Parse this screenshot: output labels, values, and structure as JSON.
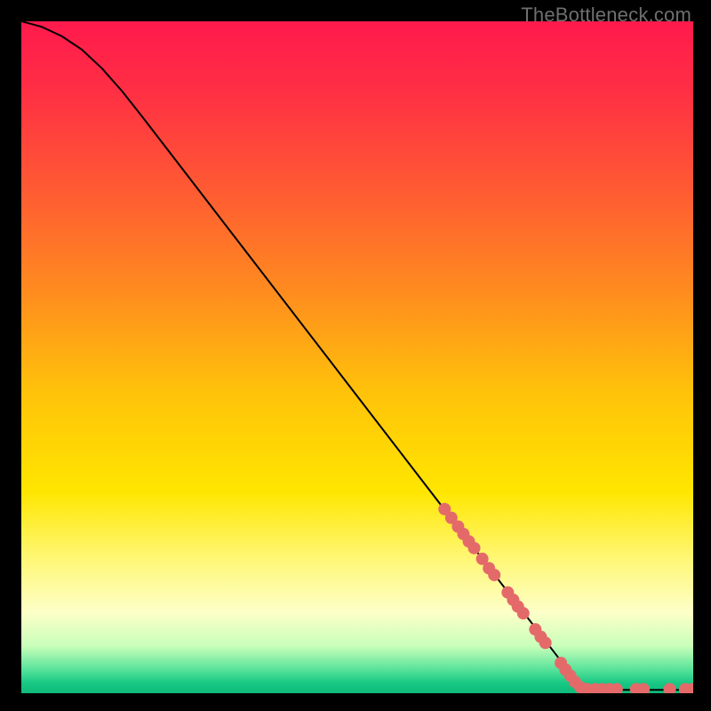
{
  "watermark": "TheBottleneck.com",
  "chart_data": {
    "type": "line",
    "title": "",
    "xlabel": "",
    "ylabel": "",
    "xlim": [
      0,
      100
    ],
    "ylim": [
      0,
      100
    ],
    "grid": false,
    "legend": false,
    "gradient_stops": [
      {
        "offset": 0.0,
        "color": "#ff1a4d"
      },
      {
        "offset": 0.1,
        "color": "#ff2e44"
      },
      {
        "offset": 0.25,
        "color": "#ff5a33"
      },
      {
        "offset": 0.4,
        "color": "#ff8b1f"
      },
      {
        "offset": 0.55,
        "color": "#ffc20a"
      },
      {
        "offset": 0.7,
        "color": "#ffe600"
      },
      {
        "offset": 0.8,
        "color": "#fff776"
      },
      {
        "offset": 0.88,
        "color": "#fdffc8"
      },
      {
        "offset": 0.93,
        "color": "#c8ffba"
      },
      {
        "offset": 0.965,
        "color": "#57e29a"
      },
      {
        "offset": 0.985,
        "color": "#17c884"
      },
      {
        "offset": 1.0,
        "color": "#0fba7a"
      }
    ],
    "series": [
      {
        "name": "curve",
        "render": "line",
        "color": "#000000",
        "points": [
          {
            "x": 0.0,
            "y": 100.0
          },
          {
            "x": 3.0,
            "y": 99.2
          },
          {
            "x": 6.0,
            "y": 97.8
          },
          {
            "x": 9.0,
            "y": 95.8
          },
          {
            "x": 12.0,
            "y": 93.0
          },
          {
            "x": 15.0,
            "y": 89.6
          },
          {
            "x": 18.0,
            "y": 85.8
          },
          {
            "x": 22.0,
            "y": 80.6
          },
          {
            "x": 28.0,
            "y": 72.8
          },
          {
            "x": 36.0,
            "y": 62.4
          },
          {
            "x": 46.0,
            "y": 49.4
          },
          {
            "x": 58.0,
            "y": 33.8
          },
          {
            "x": 66.0,
            "y": 23.4
          },
          {
            "x": 74.0,
            "y": 13.0
          },
          {
            "x": 80.0,
            "y": 5.2
          },
          {
            "x": 83.5,
            "y": 1.0
          },
          {
            "x": 85.0,
            "y": 0.5
          },
          {
            "x": 90.0,
            "y": 0.5
          },
          {
            "x": 95.0,
            "y": 0.5
          },
          {
            "x": 100.0,
            "y": 0.5
          }
        ]
      },
      {
        "name": "markers",
        "render": "scatter",
        "color": "#e46a6a",
        "radius": 7,
        "points": [
          {
            "x": 63.0,
            "y": 27.4
          },
          {
            "x": 64.0,
            "y": 26.1
          },
          {
            "x": 65.0,
            "y": 24.8
          },
          {
            "x": 65.8,
            "y": 23.7
          },
          {
            "x": 66.6,
            "y": 22.6
          },
          {
            "x": 67.4,
            "y": 21.6
          },
          {
            "x": 68.6,
            "y": 20.0
          },
          {
            "x": 69.6,
            "y": 18.6
          },
          {
            "x": 70.4,
            "y": 17.6
          },
          {
            "x": 72.4,
            "y": 15.0
          },
          {
            "x": 73.2,
            "y": 13.9
          },
          {
            "x": 73.9,
            "y": 12.9
          },
          {
            "x": 74.7,
            "y": 11.9
          },
          {
            "x": 76.5,
            "y": 9.5
          },
          {
            "x": 77.3,
            "y": 8.4
          },
          {
            "x": 78.0,
            "y": 7.5
          },
          {
            "x": 80.3,
            "y": 4.5
          },
          {
            "x": 81.0,
            "y": 3.5
          },
          {
            "x": 81.7,
            "y": 2.6
          },
          {
            "x": 82.4,
            "y": 1.7
          },
          {
            "x": 83.2,
            "y": 0.9
          },
          {
            "x": 84.2,
            "y": 0.6
          },
          {
            "x": 85.4,
            "y": 0.6
          },
          {
            "x": 86.4,
            "y": 0.6
          },
          {
            "x": 87.5,
            "y": 0.6
          },
          {
            "x": 88.6,
            "y": 0.6
          },
          {
            "x": 91.5,
            "y": 0.6
          },
          {
            "x": 92.6,
            "y": 0.6
          },
          {
            "x": 96.5,
            "y": 0.6
          },
          {
            "x": 98.8,
            "y": 0.6
          },
          {
            "x": 99.8,
            "y": 0.6
          }
        ]
      }
    ]
  }
}
